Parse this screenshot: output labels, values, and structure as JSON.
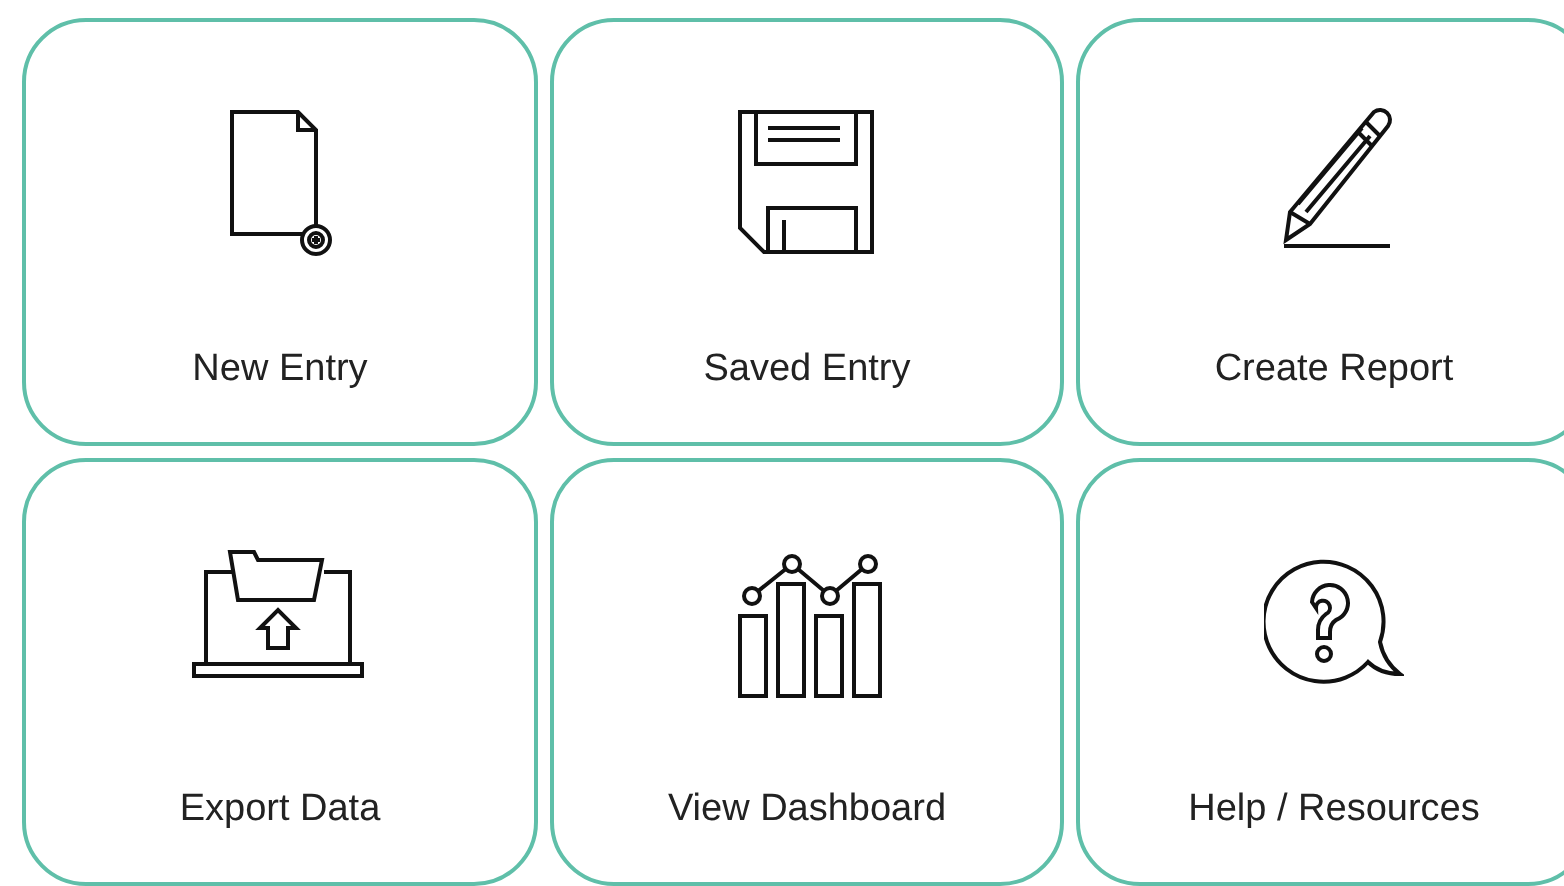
{
  "tiles": [
    {
      "label": "New Entry",
      "kind": "new"
    },
    {
      "label": "Saved Entry",
      "kind": "saved"
    },
    {
      "label": "Create Report",
      "kind": "report"
    },
    {
      "label": "Export Data",
      "kind": "export"
    },
    {
      "label": "View Dashboard",
      "kind": "dashboard"
    },
    {
      "label": "Help / Resources",
      "kind": "help"
    }
  ]
}
